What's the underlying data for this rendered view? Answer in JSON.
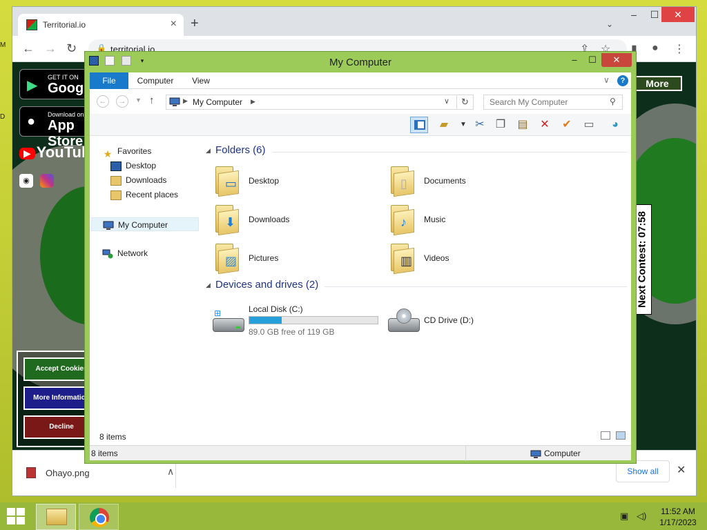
{
  "colors": {
    "desktop_accent": "#c2cd35",
    "explorer_frame": "#9ccb5a",
    "file_tab": "#1979ca",
    "close_red": "#c8463c",
    "progress_blue": "#26a0da",
    "group_header_text": "#1e3287"
  },
  "chrome": {
    "tab_title": "Territorial.io",
    "url": "territorial.io",
    "icons": {
      "tab_close": "×",
      "new_tab": "+",
      "tab_search": "⌄",
      "minimize": "–",
      "maximize": "☐",
      "close": "✕",
      "back": "←",
      "forward": "→",
      "reload": "↻",
      "lock": "🔒",
      "share": "⇪",
      "bookmark": "☆",
      "side_panel": "▮",
      "profile": "●",
      "menu": "⋮"
    }
  },
  "webpage": {
    "google_play": {
      "small": "GET IT ON",
      "big": "Google"
    },
    "app_store": {
      "small": "Download on the",
      "big": "App Store"
    },
    "youtube": "YouTube",
    "more_button": "More",
    "contest_label": "Next Contest: 07:58",
    "cookie_buttons": {
      "accept": "Accept Cookies",
      "more_info": "More Information",
      "decline": "Decline"
    }
  },
  "download_bar": {
    "file_name": "Ohayo.png",
    "show_all": "Show all",
    "icons": {
      "caret": "∧",
      "close": "✕"
    }
  },
  "explorer": {
    "title": "My Computer",
    "ribbon_tabs": [
      "File",
      "Computer",
      "View"
    ],
    "icons": {
      "help": "?",
      "expand": "∨",
      "up": "↑",
      "refresh": "↻",
      "search": "⚲",
      "dropdown": "∨"
    },
    "address": {
      "crumb": "My Computer"
    },
    "search_placeholder": "Search My Computer",
    "nav": {
      "favorites": "Favorites",
      "favorites_items": [
        "Desktop",
        "Downloads",
        "Recent places"
      ],
      "my_computer": "My Computer",
      "network": "Network"
    },
    "groups": {
      "folders": "Folders (6)",
      "devices": "Devices and drives (2)"
    },
    "folders": [
      {
        "name": "Desktop",
        "icon": "desktop-folder-icon"
      },
      {
        "name": "Documents",
        "icon": "documents-folder-icon"
      },
      {
        "name": "Downloads",
        "icon": "downloads-folder-icon"
      },
      {
        "name": "Music",
        "icon": "music-folder-icon"
      },
      {
        "name": "Pictures",
        "icon": "pictures-folder-icon"
      },
      {
        "name": "Videos",
        "icon": "videos-folder-icon"
      }
    ],
    "drives": [
      {
        "name": "Local Disk (C:)",
        "free_text": "89.0 GB free of 119 GB",
        "used_fraction": 0.25
      },
      {
        "name": "CD Drive (D:)"
      }
    ],
    "details_count": "8 items",
    "status": {
      "count": "8 items",
      "location": "Computer"
    }
  },
  "taskbar": {
    "time": "11:52 AM",
    "date": "1/17/2023"
  }
}
